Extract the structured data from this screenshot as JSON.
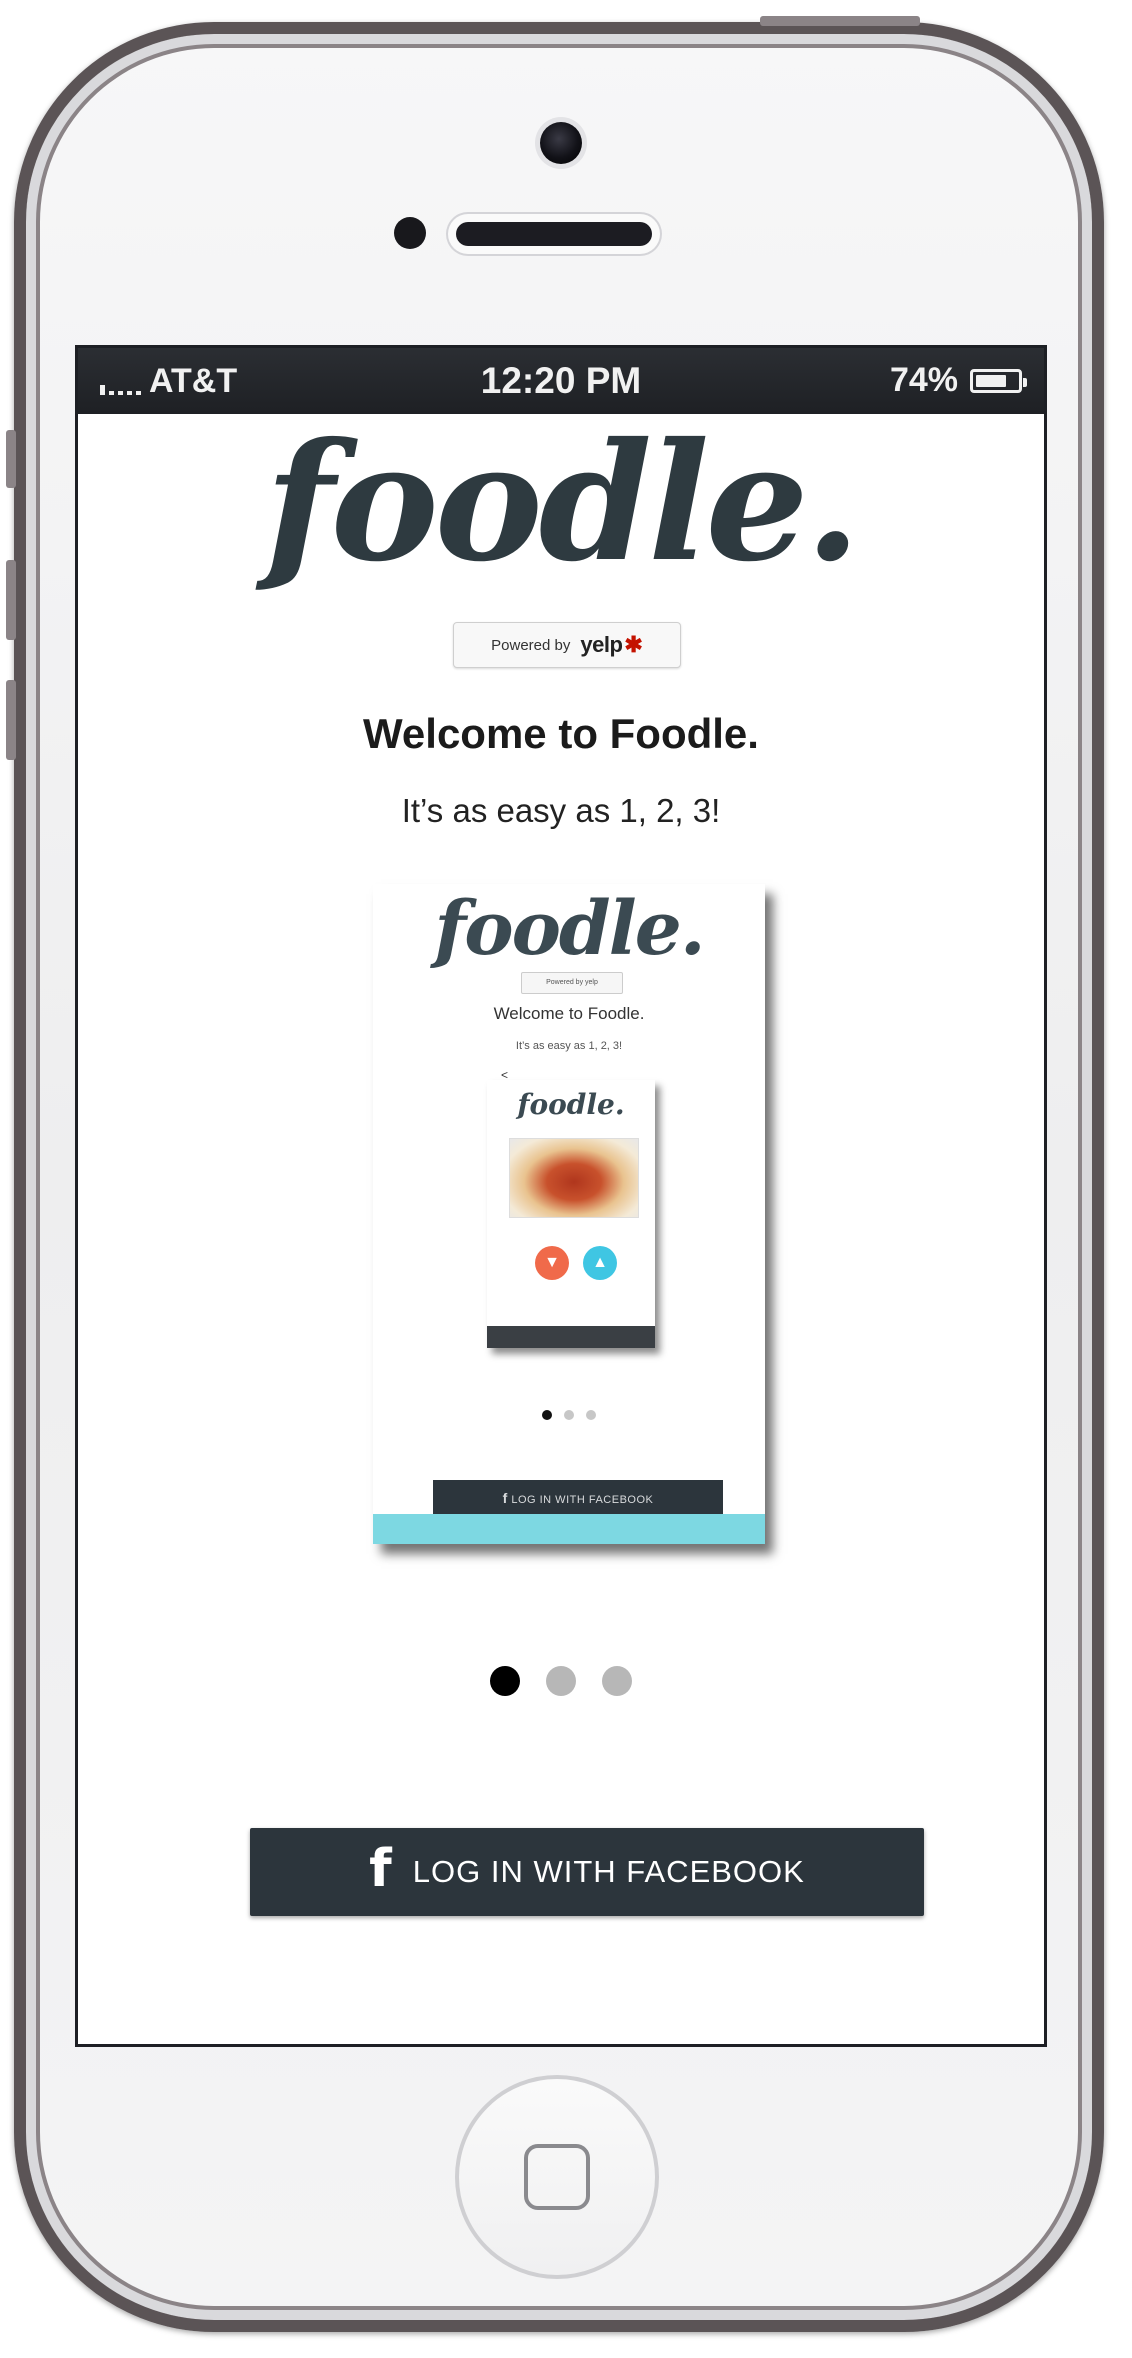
{
  "status_bar": {
    "carrier": "AT&T",
    "time": "12:20 PM",
    "battery_percent": "74%",
    "battery_level": 0.74,
    "signal_bars": 5
  },
  "app": {
    "logo_text": "foodle.",
    "powered_by": {
      "label": "Powered by",
      "brand": "yelp",
      "brand_burst_icon": "yelp-burst-icon"
    },
    "welcome_title": "Welcome to Foodle.",
    "welcome_subtitle": "It’s as easy as 1, 2, 3!",
    "carousel": {
      "slides_count": 3,
      "active_index": 0,
      "slide_preview": {
        "logo_text": "foodle.",
        "badge_text": "Powered by yelp",
        "title": "Welcome to Foodle.",
        "subtitle": "It’s as easy as 1, 2, 3!",
        "back_icon": "back-arrow-icon",
        "inner_logo_text": "foodle.",
        "dislike_icon": "thumbs-down-icon",
        "like_icon": "thumbs-up-icon",
        "login_text": "LOG IN WITH FACEBOOK",
        "active_dot": 0
      }
    },
    "login_button": {
      "icon": "facebook-icon",
      "label": "LOG IN WITH FACEBOOK"
    }
  },
  "colors": {
    "button_bg": "#2c353c",
    "status_bar_bg": "#1e2024",
    "logo": "#2e3a40",
    "accent_teal": "#7dd8e2",
    "yelp_red": "#c41200"
  }
}
